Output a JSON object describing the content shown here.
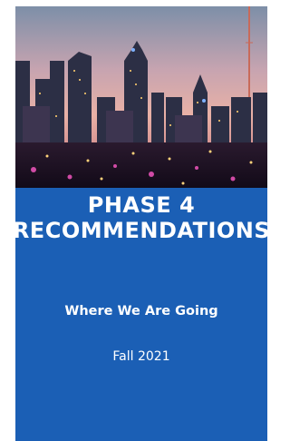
{
  "cover": {
    "image_description_icon": "city-skyline-photo",
    "title_line1": "PHASE 4",
    "title_line2": "RECOMMENDATIONS",
    "subtitle": "Where We Are Going",
    "date": "Fall 2021"
  },
  "colors": {
    "panel": "#1b5fb5",
    "text": "#ffffff"
  }
}
